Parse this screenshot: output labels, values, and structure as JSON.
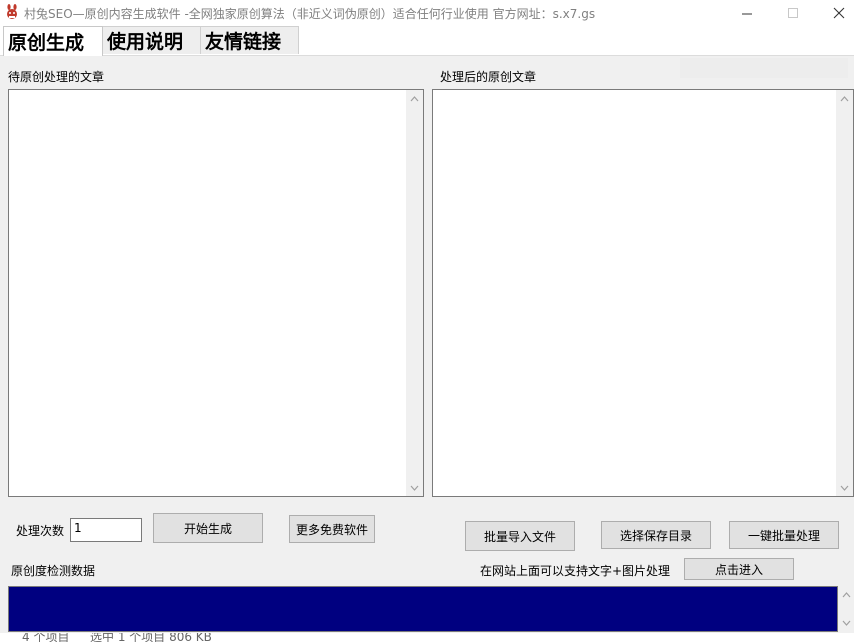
{
  "window": {
    "title": "村兔SEO—原创内容生成软件 -全网独家原创算法（非近义词伪原创）适合任何行业使用 官方网址：s.x7.gs",
    "icon": "rabbit-app-icon",
    "controls": {
      "minimize": "minimize-icon",
      "maximize": "maximize-icon",
      "close": "close-icon"
    }
  },
  "tabs": [
    {
      "label": "原创生成",
      "active": true
    },
    {
      "label": "使用说明",
      "active": false
    },
    {
      "label": "友情链接",
      "active": false
    }
  ],
  "main": {
    "source_label": "待原创处理的文章",
    "source_text": "",
    "result_label": "处理后的原创文章",
    "result_text": "",
    "count_label": "处理次数",
    "count_value": "1",
    "start_button": "开始生成",
    "more_button": "更多免费软件",
    "batch_import_button": "批量导入文件",
    "choose_dir_button": "选择保存目录",
    "batch_process_button": "一键批量处理",
    "originality_label": "原创度检测数据",
    "site_note": "在网站上面可以支持文字+图片处理",
    "enter_button": "点击进入",
    "progress_color": "#000080"
  },
  "status": {
    "left_text": "4 个项目",
    "mid_text": "选中 1 个项目  806 KB"
  }
}
